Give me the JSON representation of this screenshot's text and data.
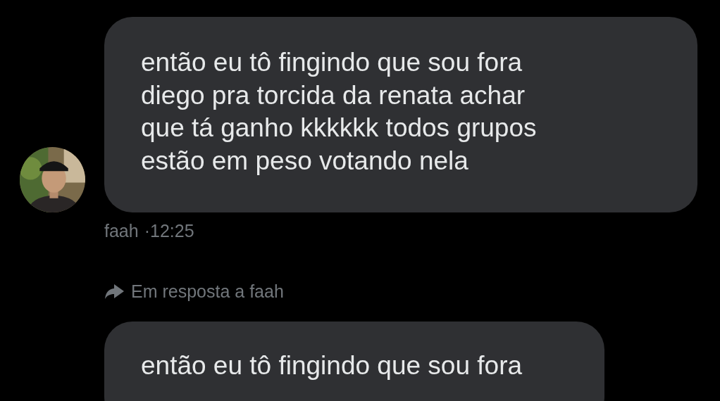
{
  "messages": [
    {
      "lines": [
        "então eu tô fingindo que sou fora",
        "diego pra torcida da renata achar",
        "que tá ganho kkkkkk todos grupos",
        "estão em peso votando nela"
      ],
      "sender": "faah",
      "time": "·12:25"
    },
    {
      "reply_to": "Em resposta a faah",
      "lines": [
        "então eu tô fingindo que sou fora"
      ]
    }
  ]
}
